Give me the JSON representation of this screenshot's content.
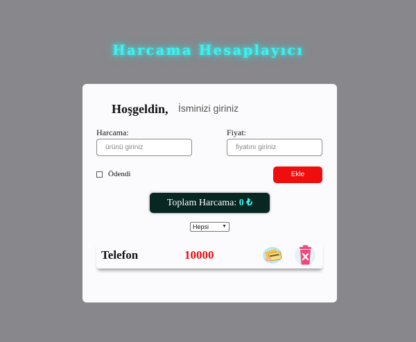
{
  "app": {
    "title": "Harcama Hesaplayıcı"
  },
  "header": {
    "welcome": "Hoşgeldin,",
    "name_placeholder": "İsminizi giriniz"
  },
  "form": {
    "expense_label": "Harcama:",
    "expense_placeholder": "ürünü giriniz",
    "price_label": "Fiyat:",
    "price_placeholder": "fiyatını giriniz",
    "paid_label": "Ödendi",
    "paid_checked": false,
    "add_label": "Ekle"
  },
  "total": {
    "label": "Toplam Harcama:",
    "value": "0",
    "currency": "₺"
  },
  "filter": {
    "selected": "Hepsi"
  },
  "expenses": [
    {
      "name": "Telefon",
      "price": "10000",
      "pay_icon": "payment-cards-icon",
      "delete_icon": "trash-icon"
    }
  ],
  "colors": {
    "background": "#88878b",
    "title": "#3ff0f0",
    "card": "#fbfbfd",
    "add_button": "#f00d0d",
    "total_box": "#082622",
    "price": "#e00f0f",
    "trash": "#ef4b7a"
  }
}
